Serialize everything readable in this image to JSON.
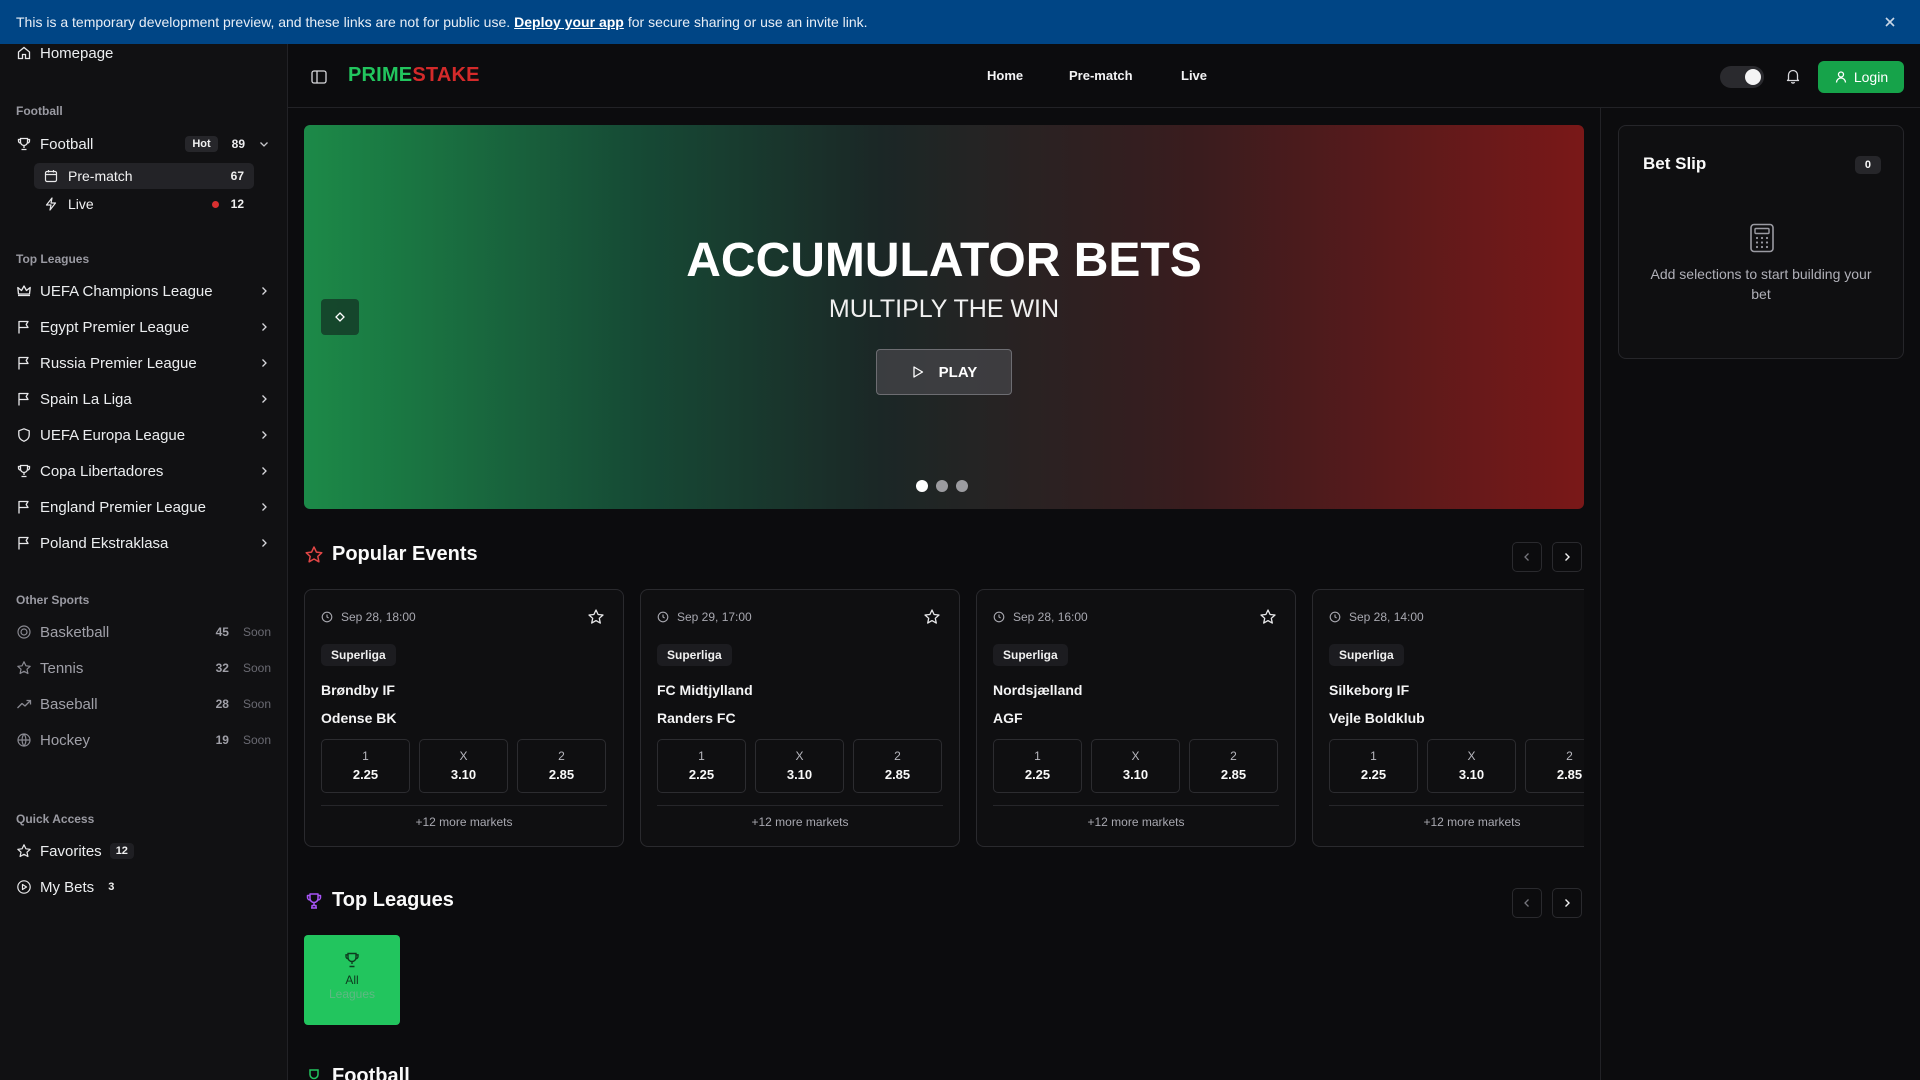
{
  "banner": {
    "text_before": "This is a temporary development preview, and these links are not for public use.",
    "link": "Deploy your app",
    "text_after": "for secure sharing or use an invite link."
  },
  "sidebar": {
    "homepage": "Homepage",
    "football_heading": "Football",
    "football": {
      "label": "Football",
      "badge": "Hot",
      "count": "89"
    },
    "prematch": {
      "label": "Pre-match",
      "count": "67"
    },
    "live": {
      "label": "Live",
      "count": "12"
    },
    "top_leagues_heading": "Top Leagues",
    "leagues": [
      {
        "label": "UEFA Champions League",
        "icon": "crown-icon"
      },
      {
        "label": "Egypt Premier League",
        "icon": "flag-icon"
      },
      {
        "label": "Russia Premier League",
        "icon": "flag-icon"
      },
      {
        "label": "Spain La Liga",
        "icon": "flag-icon"
      },
      {
        "label": "UEFA Europa League",
        "icon": "shield-icon"
      },
      {
        "label": "Copa Libertadores",
        "icon": "trophy-icon"
      },
      {
        "label": "England Premier League",
        "icon": "flag-icon"
      },
      {
        "label": "Poland Ekstraklasa",
        "icon": "flag-icon"
      }
    ],
    "other_heading": "Other Sports",
    "other": [
      {
        "label": "Basketball",
        "count": "45",
        "status": "Soon"
      },
      {
        "label": "Tennis",
        "count": "32",
        "status": "Soon"
      },
      {
        "label": "Baseball",
        "count": "28",
        "status": "Soon"
      },
      {
        "label": "Hockey",
        "count": "19",
        "status": "Soon"
      }
    ],
    "quick_heading": "Quick Access",
    "favorites": {
      "label": "Favorites",
      "count": "12"
    },
    "mybets": {
      "label": "My Bets",
      "count": "3"
    }
  },
  "header": {
    "logo_a": "PRIME",
    "logo_b": "STAKE",
    "nav": [
      "Home",
      "Pre-match",
      "Live"
    ],
    "login": "Login"
  },
  "hero": {
    "title": "ACCUMULATOR BETS",
    "subtitle": "MULTIPLY THE WIN",
    "button": "PLAY",
    "slides_total": 3,
    "active_slide": 1
  },
  "popular": {
    "title": "Popular Events",
    "cards": [
      {
        "date": "Sep 28, 18:00",
        "league": "Superliga",
        "home": "Brøndby IF",
        "away": "Odense BK",
        "odds": [
          {
            "label": "1",
            "value": "2.25"
          },
          {
            "label": "X",
            "value": "3.10"
          },
          {
            "label": "2",
            "value": "2.85"
          }
        ],
        "more": "+12 more markets"
      },
      {
        "date": "Sep 29, 17:00",
        "league": "Superliga",
        "home": "FC Midtjylland",
        "away": "Randers FC",
        "odds": [
          {
            "label": "1",
            "value": "2.25"
          },
          {
            "label": "X",
            "value": "3.10"
          },
          {
            "label": "2",
            "value": "2.85"
          }
        ],
        "more": "+12 more markets"
      },
      {
        "date": "Sep 28, 16:00",
        "league": "Superliga",
        "home": "Nordsjælland",
        "away": "AGF",
        "odds": [
          {
            "label": "1",
            "value": "2.25"
          },
          {
            "label": "X",
            "value": "3.10"
          },
          {
            "label": "2",
            "value": "2.85"
          }
        ],
        "more": "+12 more markets"
      },
      {
        "date": "Sep 28, 14:00",
        "league": "Superliga",
        "home": "Silkeborg IF",
        "away": "Vejle Boldklub",
        "odds": [
          {
            "label": "1",
            "value": "2.25"
          },
          {
            "label": "X",
            "value": "3.10"
          },
          {
            "label": "2",
            "value": "2.85"
          }
        ],
        "more": "+12 more markets"
      }
    ]
  },
  "top_leagues": {
    "title": "Top Leagues",
    "tile_line1": "All",
    "tile_line2": "Leagues"
  },
  "football_section": {
    "title": "Football"
  },
  "betslip": {
    "title": "Bet Slip",
    "count": "0",
    "empty": "Add selections to start building your bet"
  },
  "colors": {
    "accent_green": "#22c55e",
    "accent_red": "#d42a2a",
    "banner_blue": "#004585",
    "live_red": "#d93030"
  }
}
